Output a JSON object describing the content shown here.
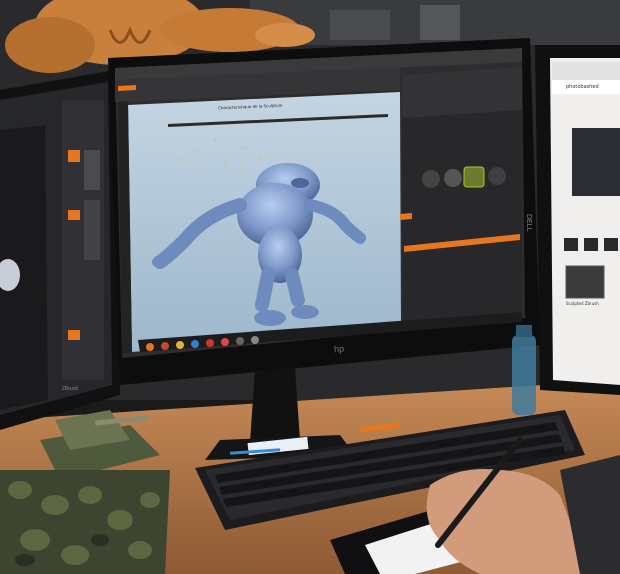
{
  "colors": {
    "wall": "#2a2a2c",
    "desk": "#b07a4e",
    "desk_dark": "#7a4f2f",
    "viewport": "#aec4d6",
    "ui_dark": "#2d2d2f",
    "accent": "#e8761f",
    "model": "#7d98c9",
    "keyboard": "#222225",
    "mat": "#f2f2f2"
  },
  "main_monitor": {
    "brand": "hp",
    "viewport_caption": "Characteristique de la Sculpture"
  },
  "left_monitor": {
    "brand": "ZBrush"
  },
  "right_monitor": {
    "brand": "DELL",
    "site_name": "photobashed",
    "card_label": "Sculpted Zbrush"
  }
}
